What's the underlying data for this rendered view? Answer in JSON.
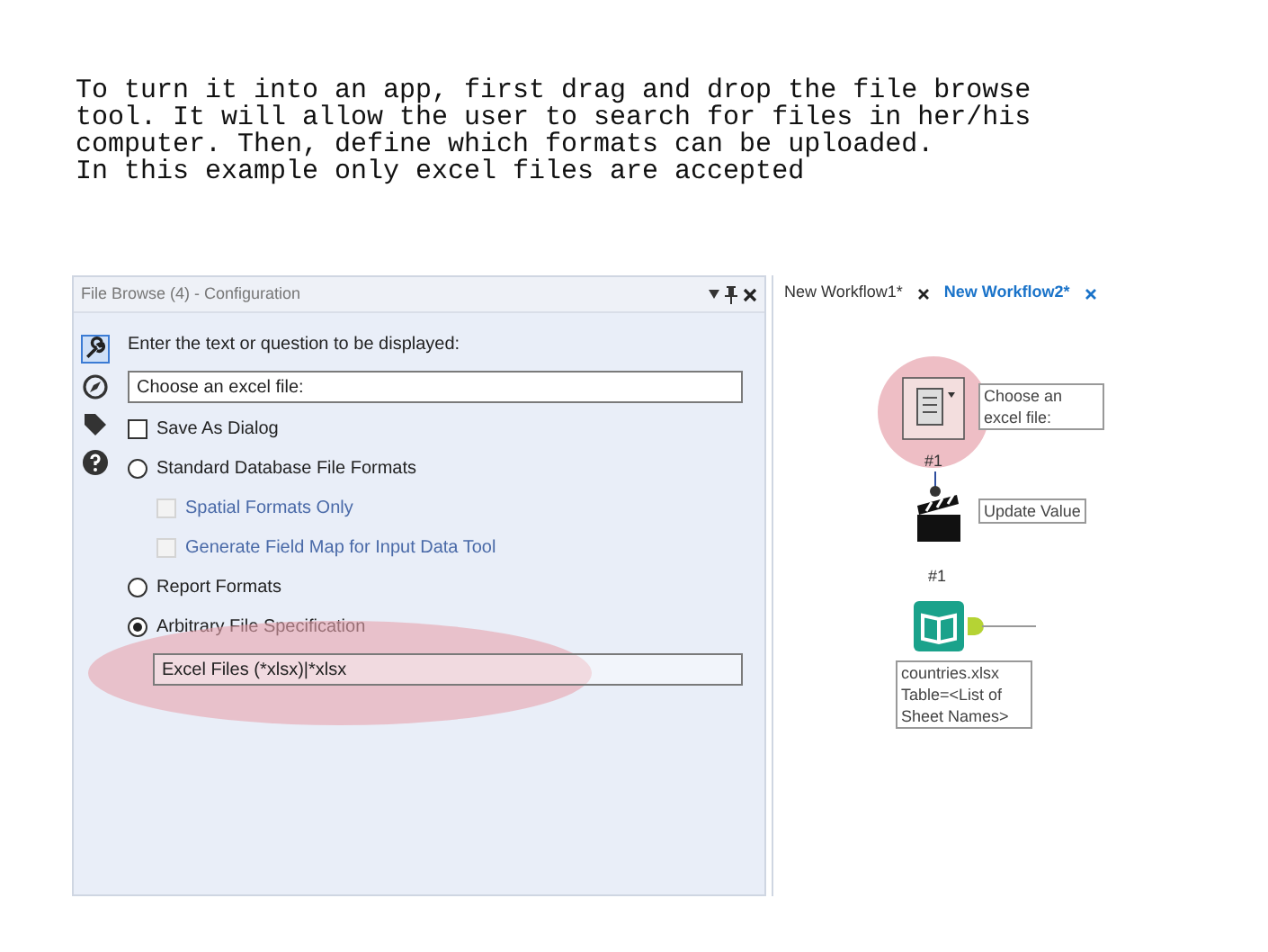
{
  "caption": "To turn it into an app, first drag and drop the file browse\ntool. It will allow the user to search for files in her/his\ncomputer. Then, define which formats can be uploaded.\nIn this example only excel files are accepted",
  "panel": {
    "title": "File Browse (4) - Configuration",
    "side_tools": [
      {
        "kind": "wrench",
        "selected": true
      },
      {
        "kind": "compass",
        "selected": false
      },
      {
        "kind": "tag",
        "selected": false
      },
      {
        "kind": "help",
        "selected": false
      }
    ],
    "rows": [
      {
        "kind": "label",
        "text": "Enter the text or question to be displayed:"
      },
      {
        "kind": "field",
        "value": "Choose an excel file:",
        "highlighted": false
      },
      {
        "kind": "checkbox",
        "text": "Save As Dialog",
        "checked": false,
        "disabled": false
      },
      {
        "kind": "radio",
        "text": "Standard Database File Formats",
        "selected": false
      },
      {
        "kind": "checkbox",
        "text": "Spatial Formats Only",
        "checked": false,
        "disabled": true
      },
      {
        "kind": "checkbox",
        "text": "Generate Field Map for Input Data Tool",
        "checked": false,
        "disabled": true
      },
      {
        "kind": "radio",
        "text": "Report Formats",
        "selected": false
      },
      {
        "kind": "radio",
        "text": "Arbitrary File Specification",
        "selected": true
      },
      {
        "kind": "field",
        "value": "Excel Files (*xlsx)|*xlsx",
        "highlighted": true
      }
    ]
  },
  "tabs": [
    {
      "label": "New Workflow1*",
      "selected": false
    },
    {
      "label": "New Workflow2*",
      "selected": true
    }
  ],
  "workflow": {
    "nodes": [
      {
        "kind": "file_browse",
        "number": "#1",
        "annotation": "Choose an excel file:",
        "highlighted": true
      },
      {
        "kind": "action",
        "annotation": "Update Value"
      },
      {
        "kind": "input",
        "number": "#1",
        "annotation": "countries.xlsx\nTable=<List of Sheet Names>"
      }
    ]
  }
}
